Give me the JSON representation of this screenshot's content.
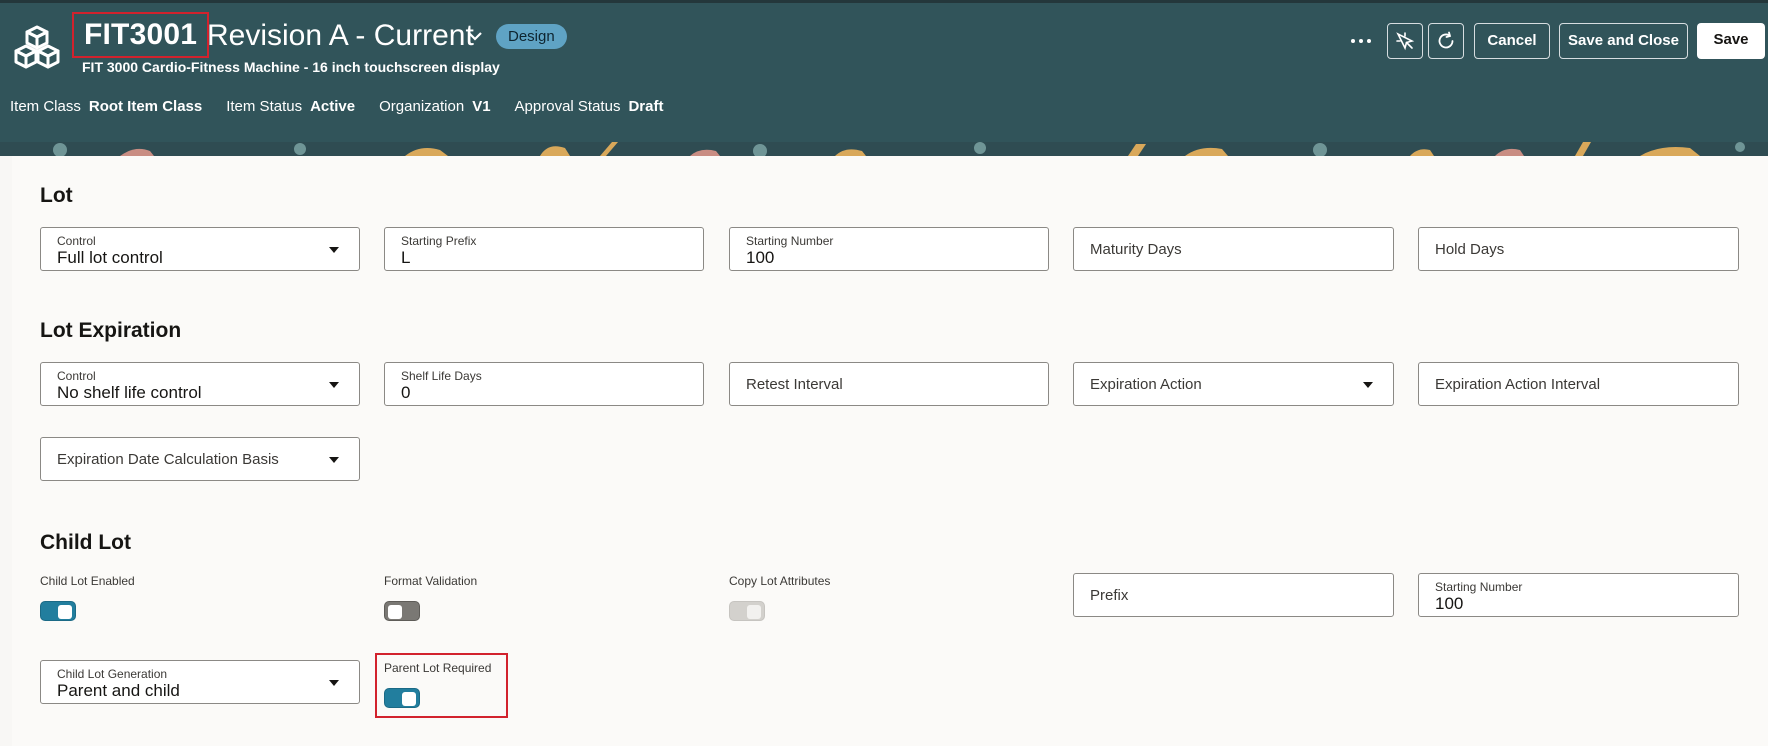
{
  "header": {
    "item_number": "FIT3001",
    "revision": "Revision A - Current",
    "lifecycle_badge": "Design",
    "description": "FIT 3000 Cardio-Fitness Machine - 16 inch touchscreen display",
    "meta": [
      {
        "label": "Item Class",
        "value": "Root Item Class"
      },
      {
        "label": "Item Status",
        "value": "Active"
      },
      {
        "label": "Organization",
        "value": "V1"
      },
      {
        "label": "Approval Status",
        "value": "Draft"
      }
    ],
    "buttons": {
      "cancel": "Cancel",
      "save_close": "Save and Close",
      "save": "Save"
    },
    "icons": [
      "more-actions-icon",
      "quick-pick-icon",
      "refresh-icon",
      "chevron-down-icon",
      "product-cubes-logo"
    ]
  },
  "lot": {
    "title": "Lot",
    "control": {
      "label": "Control",
      "value": "Full lot control"
    },
    "starting_prefix": {
      "label": "Starting Prefix",
      "value": "L"
    },
    "starting_number": {
      "label": "Starting Number",
      "value": "100"
    },
    "maturity_days": {
      "label": "Maturity Days"
    },
    "hold_days": {
      "label": "Hold Days"
    }
  },
  "lot_expiration": {
    "title": "Lot Expiration",
    "control": {
      "label": "Control",
      "value": "No shelf life control"
    },
    "shelf_life_days": {
      "label": "Shelf Life Days",
      "value": "0"
    },
    "retest_interval": {
      "label": "Retest Interval"
    },
    "expiration_action": {
      "label": "Expiration Action"
    },
    "expiration_action_interval": {
      "label": "Expiration Action Interval"
    },
    "expiration_date_basis": {
      "label": "Expiration Date Calculation Basis"
    }
  },
  "child_lot": {
    "title": "Child Lot",
    "enabled": {
      "label": "Child Lot Enabled",
      "state": "on"
    },
    "format_validation": {
      "label": "Format Validation",
      "state": "off"
    },
    "copy_lot_attributes": {
      "label": "Copy Lot Attributes",
      "state": "disabled"
    },
    "prefix": {
      "label": "Prefix"
    },
    "starting_number": {
      "label": "Starting Number",
      "value": "100"
    },
    "generation": {
      "label": "Child Lot Generation",
      "value": "Parent and child"
    },
    "parent_lot_required": {
      "label": "Parent Lot Required",
      "state": "on"
    }
  },
  "colors": {
    "header_bg": "#31545a",
    "badge_bg": "#5fa3c4",
    "switch_on": "#227e9e",
    "highlight": "#d2222d"
  }
}
